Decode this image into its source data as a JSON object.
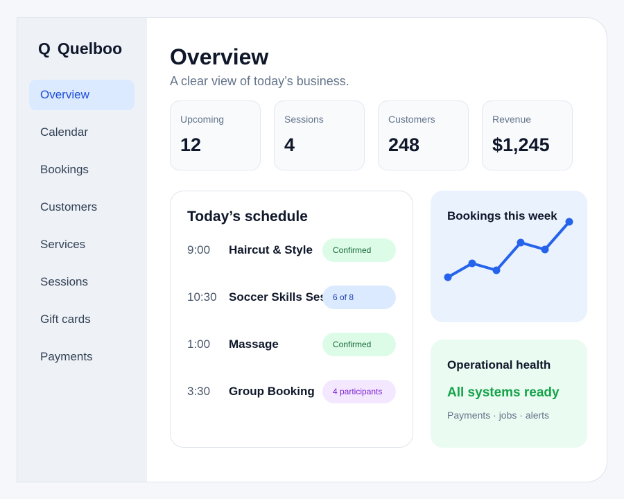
{
  "brand": {
    "mark": "Q",
    "name": "Quelboo"
  },
  "sidebar": {
    "items": [
      {
        "label": "Overview",
        "active": true
      },
      {
        "label": "Calendar"
      },
      {
        "label": "Bookings"
      },
      {
        "label": "Customers"
      },
      {
        "label": "Services"
      },
      {
        "label": "Sessions"
      },
      {
        "label": "Gift cards"
      },
      {
        "label": "Payments"
      }
    ]
  },
  "header": {
    "title": "Overview",
    "subtitle": "A clear view of today’s business."
  },
  "stats": [
    {
      "label": "Upcoming",
      "value": "12"
    },
    {
      "label": "Sessions",
      "value": "4"
    },
    {
      "label": "Customers",
      "value": "248"
    },
    {
      "label": "Revenue",
      "value": "$1,245"
    }
  ],
  "schedule": {
    "title": "Today’s schedule",
    "rows": [
      {
        "time": "9:00",
        "name": "Haircut & Style",
        "status": "Confirmed"
      },
      {
        "time": "10:30",
        "name": "Soccer Skills Session",
        "status": "6 of 8"
      },
      {
        "time": "1:00",
        "name": "Massage",
        "status": "Confirmed"
      },
      {
        "time": "3:30",
        "name": "Group Booking",
        "status": "4 participants"
      }
    ]
  },
  "bookings_chart": {
    "title": "Bookings this week"
  },
  "chart_data": {
    "type": "line",
    "title": "Bookings this week",
    "series": [
      {
        "values": [
          2,
          4,
          3,
          7,
          6,
          10
        ]
      }
    ],
    "ylim": [
      0,
      10
    ],
    "grid": false,
    "legend": "none",
    "color": "#2563eb"
  },
  "health": {
    "title": "Operational health",
    "status": "All systems ready",
    "detail": "Payments · jobs · alerts"
  },
  "colors": {
    "accent": "#2563eb",
    "success": "#16a34a"
  }
}
